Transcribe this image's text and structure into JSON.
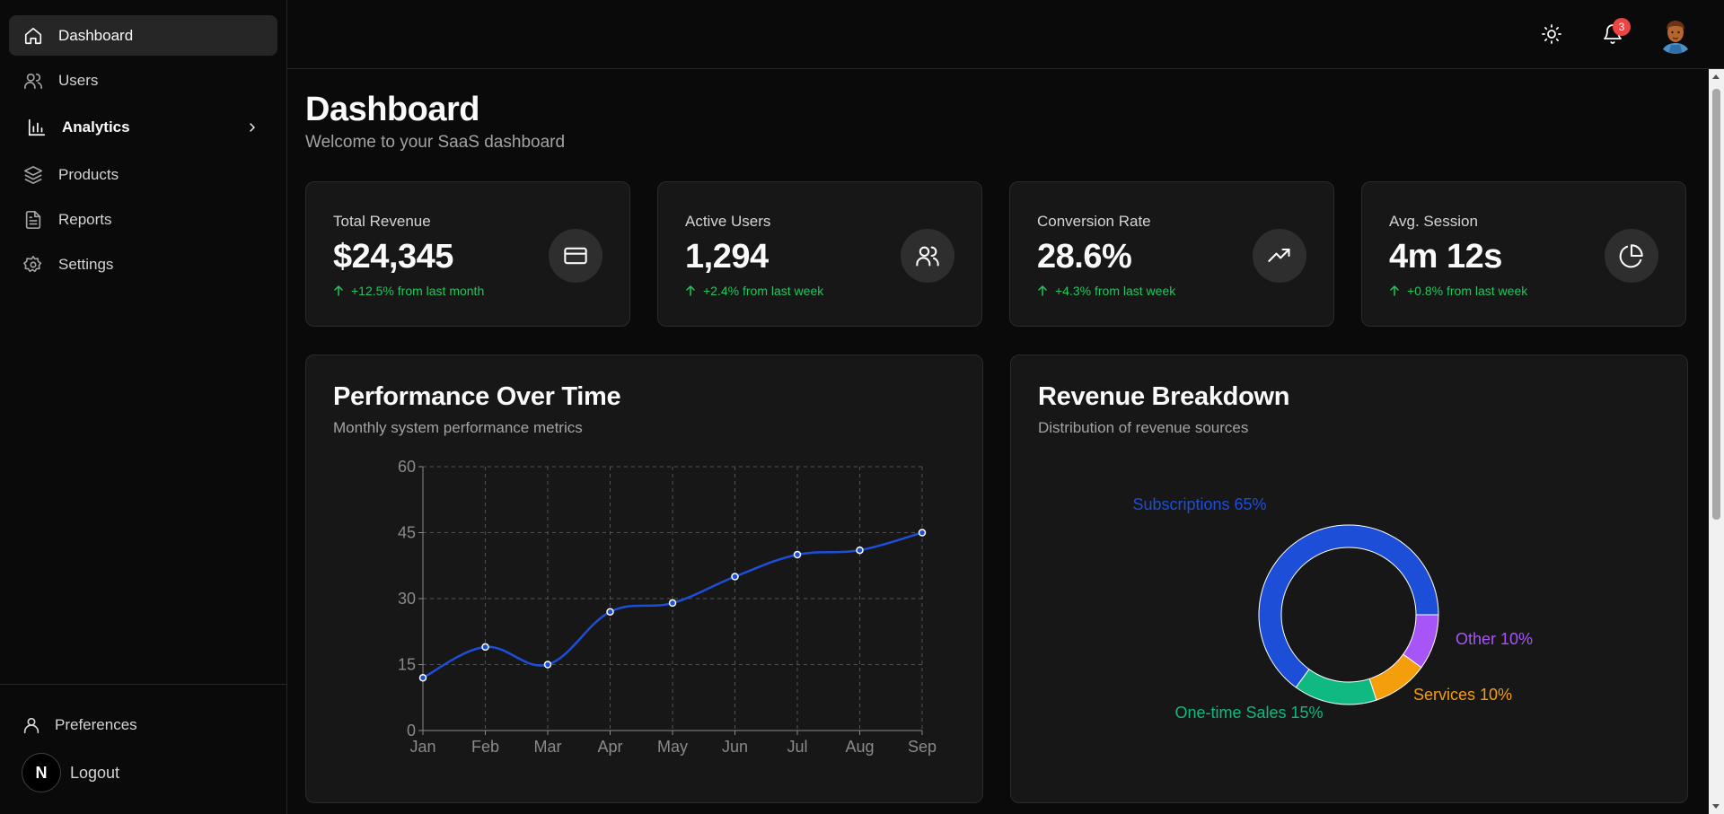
{
  "sidebar": {
    "items": [
      {
        "label": "Dashboard",
        "icon": "home-icon"
      },
      {
        "label": "Users",
        "icon": "users-icon"
      },
      {
        "label": "Analytics",
        "icon": "bar-chart-icon"
      },
      {
        "label": "Products",
        "icon": "layers-icon"
      },
      {
        "label": "Reports",
        "icon": "file-text-icon"
      },
      {
        "label": "Settings",
        "icon": "gear-icon"
      }
    ],
    "preferences_label": "Preferences",
    "logout_label": "Logout",
    "logo_letter": "N"
  },
  "topbar": {
    "notification_count": "3"
  },
  "page": {
    "title": "Dashboard",
    "subtitle": "Welcome to your SaaS dashboard"
  },
  "stats": [
    {
      "label": "Total Revenue",
      "value": "$24,345",
      "change": "+12.5% from last month",
      "icon": "credit-card-icon"
    },
    {
      "label": "Active Users",
      "value": "1,294",
      "change": "+2.4% from last week",
      "icon": "users-icon"
    },
    {
      "label": "Conversion Rate",
      "value": "28.6%",
      "change": "+4.3% from last week",
      "icon": "trending-up-icon"
    },
    {
      "label": "Avg. Session",
      "value": "4m 12s",
      "change": "+0.8% from last week",
      "icon": "pie-chart-icon"
    }
  ],
  "colors": {
    "accent_positive": "#22c55e",
    "line_series": "#1d4ed8",
    "badge": "#ef4444"
  },
  "performance_card": {
    "title": "Performance Over Time",
    "subtitle": "Monthly system performance metrics"
  },
  "revenue_card": {
    "title": "Revenue Breakdown",
    "subtitle": "Distribution of revenue sources"
  },
  "chart_data": [
    {
      "type": "line",
      "x": [
        "Jan",
        "Feb",
        "Mar",
        "Apr",
        "May",
        "Jun",
        "Jul",
        "Aug",
        "Sep"
      ],
      "series": [
        {
          "values": [
            12,
            19,
            15,
            27,
            29,
            35,
            40,
            41,
            45
          ],
          "color": "#1d4ed8"
        }
      ],
      "ylim": [
        0,
        60
      ],
      "yticks": [
        0,
        15,
        30,
        45,
        60
      ],
      "grid": true,
      "title": "",
      "xlabel": "",
      "ylabel": ""
    },
    {
      "type": "pie",
      "donut": true,
      "slices": [
        {
          "label": "Subscriptions 65%",
          "value": 65,
          "color": "#1d4ed8"
        },
        {
          "label": "Other 10%",
          "value": 10,
          "color": "#a855f7"
        },
        {
          "label": "Services 10%",
          "value": 10,
          "color": "#f59e0b"
        },
        {
          "label": "One-time Sales 15%",
          "value": 15,
          "color": "#10b981"
        }
      ]
    }
  ]
}
